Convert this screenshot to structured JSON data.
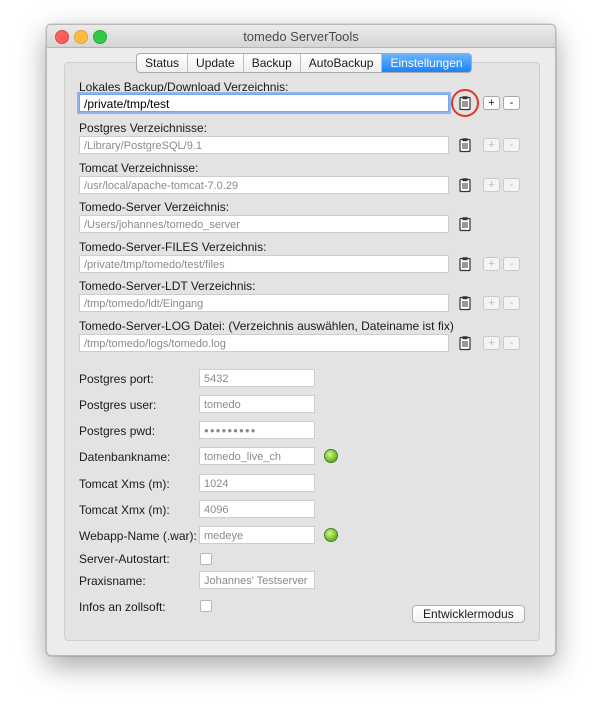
{
  "window": {
    "title": "tomedo ServerTools"
  },
  "tabs": [
    {
      "label": "Status",
      "active": false
    },
    {
      "label": "Update",
      "active": false
    },
    {
      "label": "Backup",
      "active": false
    },
    {
      "label": "AutoBackup",
      "active": false
    },
    {
      "label": "Einstellungen",
      "active": true
    }
  ],
  "dirs": [
    {
      "label": "Lokales Backup/Download Verzeichnis:",
      "value": "/private/tmp/test",
      "focused": true
    },
    {
      "label": "Postgres Verzeichnisse:",
      "value": "/Library/PostgreSQL/9.1"
    },
    {
      "label": "Tomcat Verzeichnisse:",
      "value": "/usr/local/apache-tomcat-7.0.29"
    },
    {
      "label": "Tomedo-Server Verzeichnis:",
      "value": "/Users/johannes/tomedo_server"
    },
    {
      "label": "Tomedo-Server-FILES Verzeichnis:",
      "value": "/private/tmp/tomedo/test/files"
    },
    {
      "label": "Tomedo-Server-LDT Verzeichnis:",
      "value": "/tmp/tomedo/ldt/Eingang"
    },
    {
      "label": "Tomedo-Server-LOG Datei: (Verzeichnis auswählen, Dateiname ist fix)",
      "value": "/tmp/tomedo/logs/tomedo.log"
    }
  ],
  "buttons": {
    "plus": "+",
    "minus": "-"
  },
  "settings": [
    {
      "label": "Postgres port:",
      "value": "5432"
    },
    {
      "label": "Postgres user:",
      "value": "tomedo"
    },
    {
      "label": "Postgres pwd:",
      "value": "●●●●●●●●●"
    },
    {
      "label": "Datenbankname:",
      "value": "tomedo_live_ch"
    },
    {
      "label": "Tomcat Xms (m):",
      "value": "1024"
    },
    {
      "label": "Tomcat Xmx (m):",
      "value": "4096"
    },
    {
      "label": "Webapp-Name (.war):",
      "value": "medeye"
    },
    {
      "label": "Server-Autostart:",
      "value": ""
    },
    {
      "label": "Praxisname:",
      "value": "Johannes' Testserver"
    },
    {
      "label": "Infos an zollsoft:",
      "value": ""
    }
  ],
  "dev_button": "Entwicklermodus",
  "colors": {
    "accent": "#1a82fb",
    "highlight": "#e0352a",
    "status_ok": "#8ccf3c"
  },
  "icons": {
    "dir_picker": "clipboard-icon",
    "status": "status-led-green"
  }
}
